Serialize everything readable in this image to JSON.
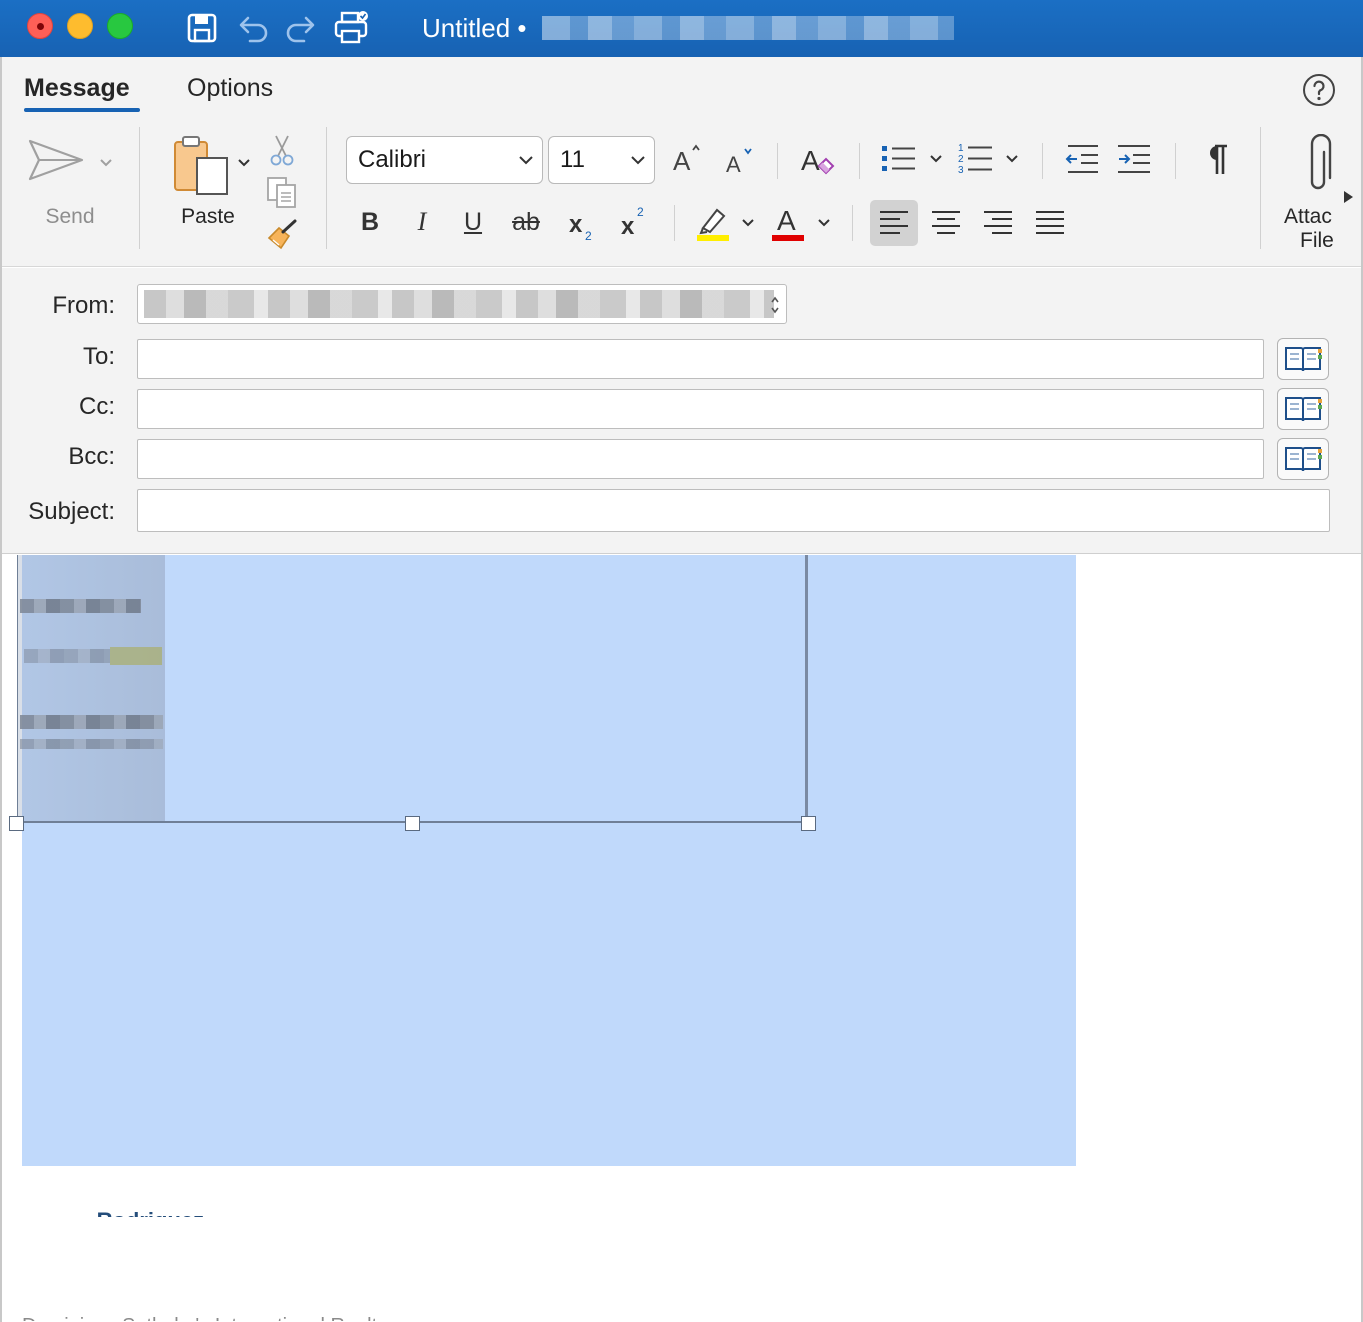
{
  "window": {
    "title": "Untitled",
    "title_separator": "•",
    "title_account_redacted": ""
  },
  "ribbon": {
    "tabs": [
      {
        "label": "Message",
        "active": true
      },
      {
        "label": "Options",
        "active": false
      }
    ],
    "send_label": "Send",
    "paste_label": "Paste",
    "font_name": "Calibri",
    "font_size": "11",
    "attach_label_line1": "Attac",
    "attach_label_line2": "File"
  },
  "fields": {
    "from_label": "From:",
    "to_label": "To:",
    "cc_label": "Cc:",
    "bcc_label": "Bcc:",
    "subject_label": "Subject:",
    "to_value": "",
    "cc_value": "",
    "bcc_value": "",
    "subject_value": ""
  },
  "body": {
    "signature_name_partial": "Rodriquez",
    "signature_company_partial": "Dominican Sotheby's International Realty"
  },
  "colors": {
    "accent": "#1762b3",
    "selection": "#c0d9fb",
    "highlight_yellow": "#ffee00",
    "font_color_red": "#e00000"
  }
}
